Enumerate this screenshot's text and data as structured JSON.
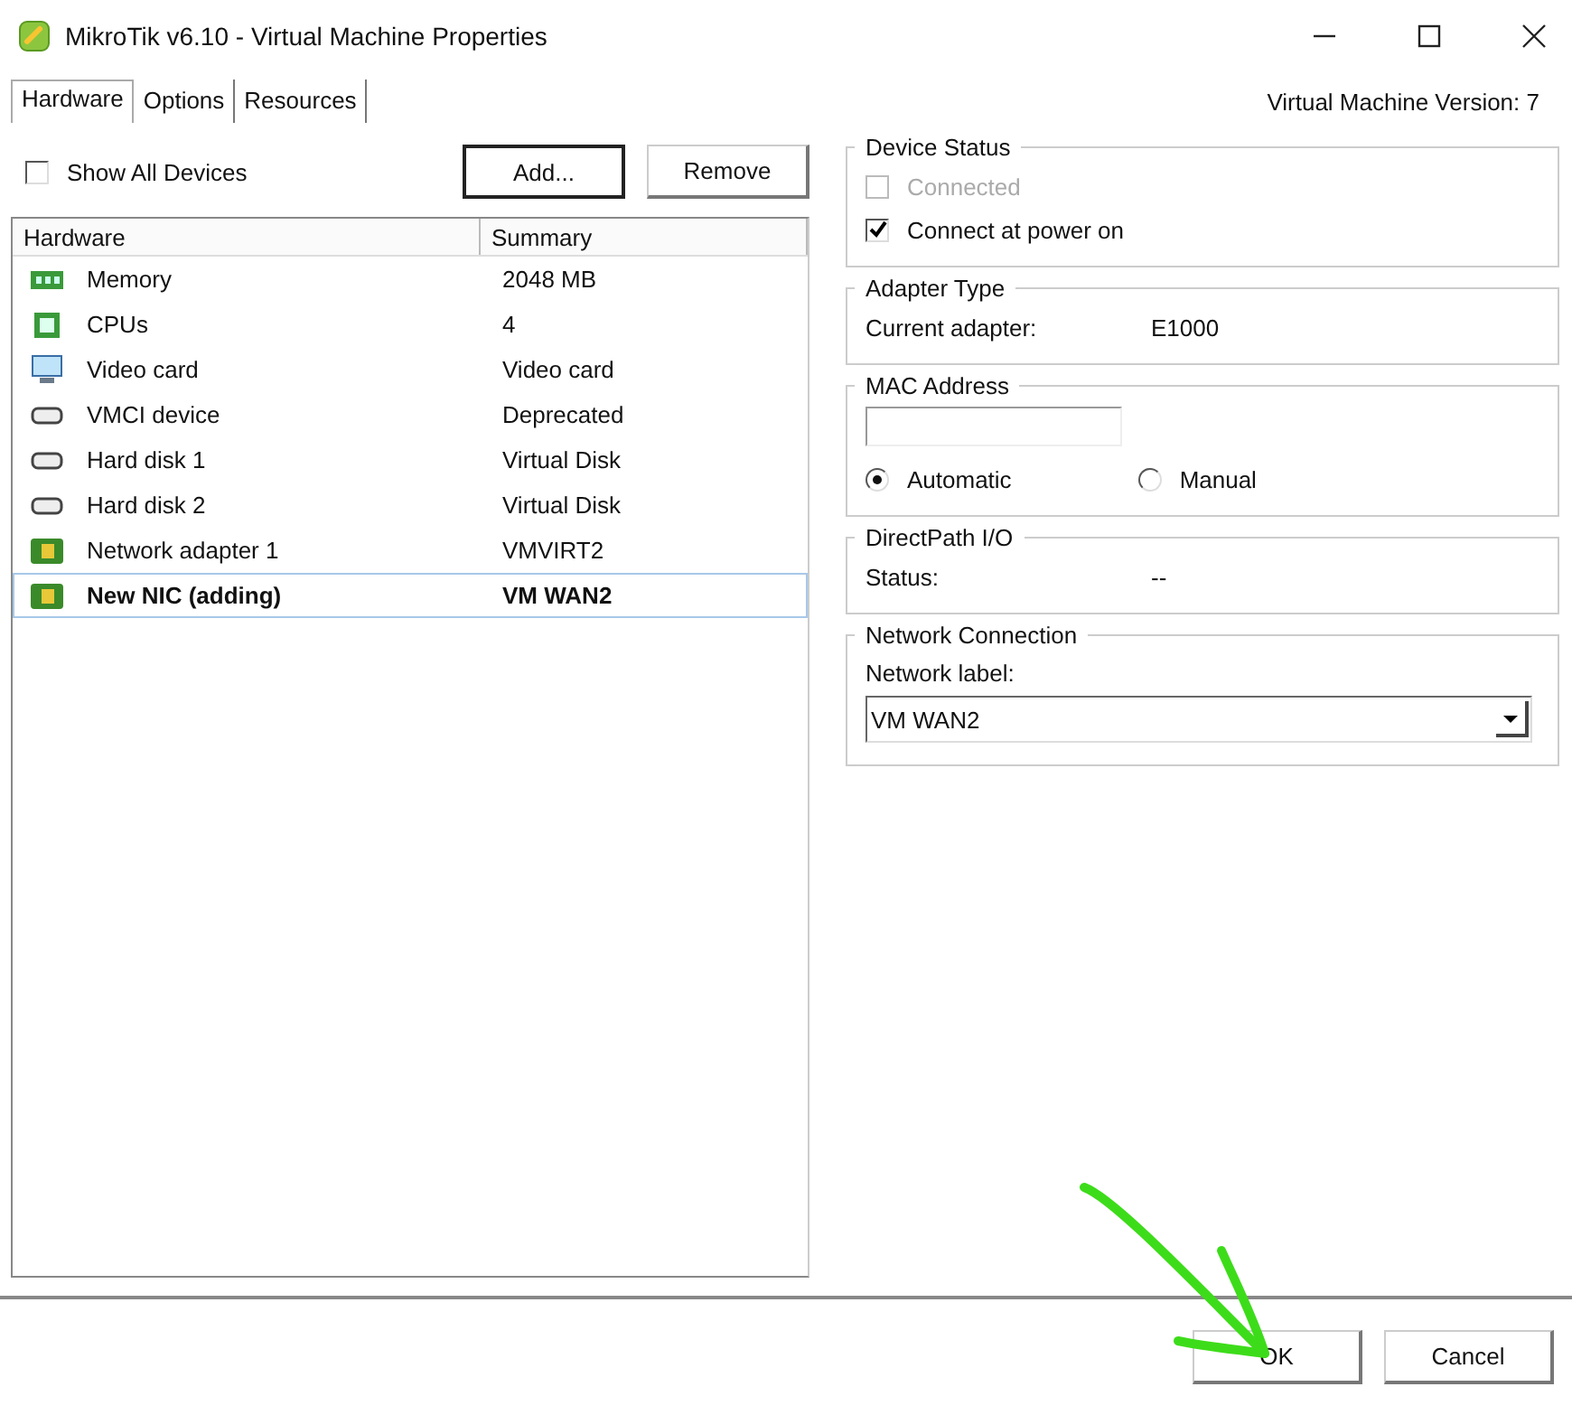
{
  "window": {
    "title": "MikroTik v6.10 - Virtual Machine Properties"
  },
  "tabs": [
    {
      "label": "Hardware",
      "selected": true
    },
    {
      "label": "Options",
      "selected": false
    },
    {
      "label": "Resources",
      "selected": false
    }
  ],
  "version": "Virtual Machine Version: 7",
  "show_all_devices": {
    "label": "Show All Devices",
    "checked": false
  },
  "list_buttons": [
    {
      "label": "Add...",
      "focused": true
    },
    {
      "label": "Remove",
      "focused": false
    }
  ],
  "table": {
    "columns": [
      "Hardware",
      "Summary"
    ],
    "rows": [
      {
        "kind": "memory",
        "hardware": "Memory",
        "summary": "2048 MB",
        "selected": false
      },
      {
        "kind": "cpu",
        "hardware": "CPUs",
        "summary": "4",
        "selected": false
      },
      {
        "kind": "display",
        "hardware": "Video card",
        "summary": "Video card",
        "selected": false
      },
      {
        "kind": "disk",
        "hardware": "VMCI device",
        "summary": "Deprecated",
        "selected": false
      },
      {
        "kind": "disk",
        "hardware": "Hard disk 1",
        "summary": "Virtual Disk",
        "selected": false
      },
      {
        "kind": "disk",
        "hardware": "Hard disk 2",
        "summary": "Virtual Disk",
        "selected": false
      },
      {
        "kind": "nic",
        "hardware": "Network adapter 1",
        "summary": "VMVIRT2",
        "selected": false
      },
      {
        "kind": "nic",
        "hardware": "New NIC (adding)",
        "summary": "VM WAN2",
        "selected": true
      }
    ]
  },
  "device_status": {
    "title": "Device Status",
    "options": [
      {
        "label": "Connected",
        "checked": false,
        "disabled": true
      },
      {
        "label": "Connect at power on",
        "checked": true,
        "disabled": false
      }
    ]
  },
  "adapter_type": {
    "title": "Adapter Type",
    "label": "Current adapter:",
    "value": "E1000"
  },
  "mac_address": {
    "title": "MAC Address",
    "modes": [
      {
        "label": "Automatic",
        "selected": true
      },
      {
        "label": "Manual",
        "selected": false
      }
    ]
  },
  "directpath": {
    "title": "DirectPath I/O",
    "label": "Status:",
    "value": "--"
  },
  "network_connection": {
    "title": "Network Connection",
    "label": "Network label:",
    "value": "VM WAN2"
  },
  "footer_buttons": [
    "OK",
    "Cancel"
  ]
}
